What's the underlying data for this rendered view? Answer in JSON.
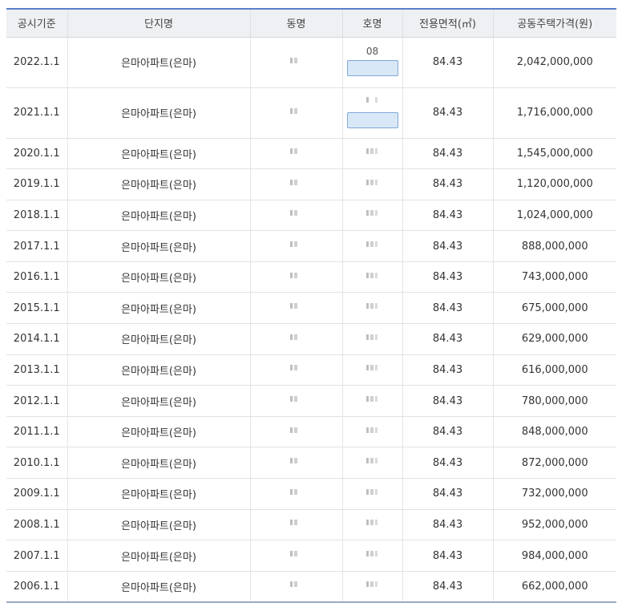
{
  "table": {
    "headers": [
      "공시기준",
      "단지명",
      "동명",
      "호명",
      "전용면적(㎡)",
      "공동주택가격(원)"
    ],
    "rows": [
      {
        "date": "2022.1.1",
        "complex": "은마아파트(은마)",
        "ho_partial": "08",
        "area": "84.43",
        "price": "2,042,000,000"
      },
      {
        "date": "2021.1.1",
        "complex": "은마아파트(은마)",
        "area": "84.43",
        "price": "1,716,000,000"
      },
      {
        "date": "2020.1.1",
        "complex": "은마아파트(은마)",
        "area": "84.43",
        "price": "1,545,000,000"
      },
      {
        "date": "2019.1.1",
        "complex": "은마아파트(은마)",
        "area": "84.43",
        "price": "1,120,000,000"
      },
      {
        "date": "2018.1.1",
        "complex": "은마아파트(은마)",
        "area": "84.43",
        "price": "1,024,000,000"
      },
      {
        "date": "2017.1.1",
        "complex": "은마아파트(은마)",
        "area": "84.43",
        "price": "888,000,000"
      },
      {
        "date": "2016.1.1",
        "complex": "은마아파트(은마)",
        "area": "84.43",
        "price": "743,000,000"
      },
      {
        "date": "2015.1.1",
        "complex": "은마아파트(은마)",
        "area": "84.43",
        "price": "675,000,000"
      },
      {
        "date": "2014.1.1",
        "complex": "은마아파트(은마)",
        "area": "84.43",
        "price": "629,000,000"
      },
      {
        "date": "2013.1.1",
        "complex": "은마아파트(은마)",
        "area": "84.43",
        "price": "616,000,000"
      },
      {
        "date": "2012.1.1",
        "complex": "은마아파트(은마)",
        "area": "84.43",
        "price": "780,000,000"
      },
      {
        "date": "2011.1.1",
        "complex": "은마아파트(은마)",
        "area": "84.43",
        "price": "848,000,000"
      },
      {
        "date": "2010.1.1",
        "complex": "은마아파트(은마)",
        "area": "84.43",
        "price": "872,000,000"
      },
      {
        "date": "2009.1.1",
        "complex": "은마아파트(은마)",
        "area": "84.43",
        "price": "732,000,000"
      },
      {
        "date": "2008.1.1",
        "complex": "은마아파트(은마)",
        "area": "84.43",
        "price": "952,000,000"
      },
      {
        "date": "2007.1.1",
        "complex": "은마아파트(은마)",
        "area": "84.43",
        "price": "984,000,000"
      },
      {
        "date": "2006.1.1",
        "complex": "은마아파트(은마)",
        "area": "84.43",
        "price": "662,000,000"
      }
    ]
  }
}
